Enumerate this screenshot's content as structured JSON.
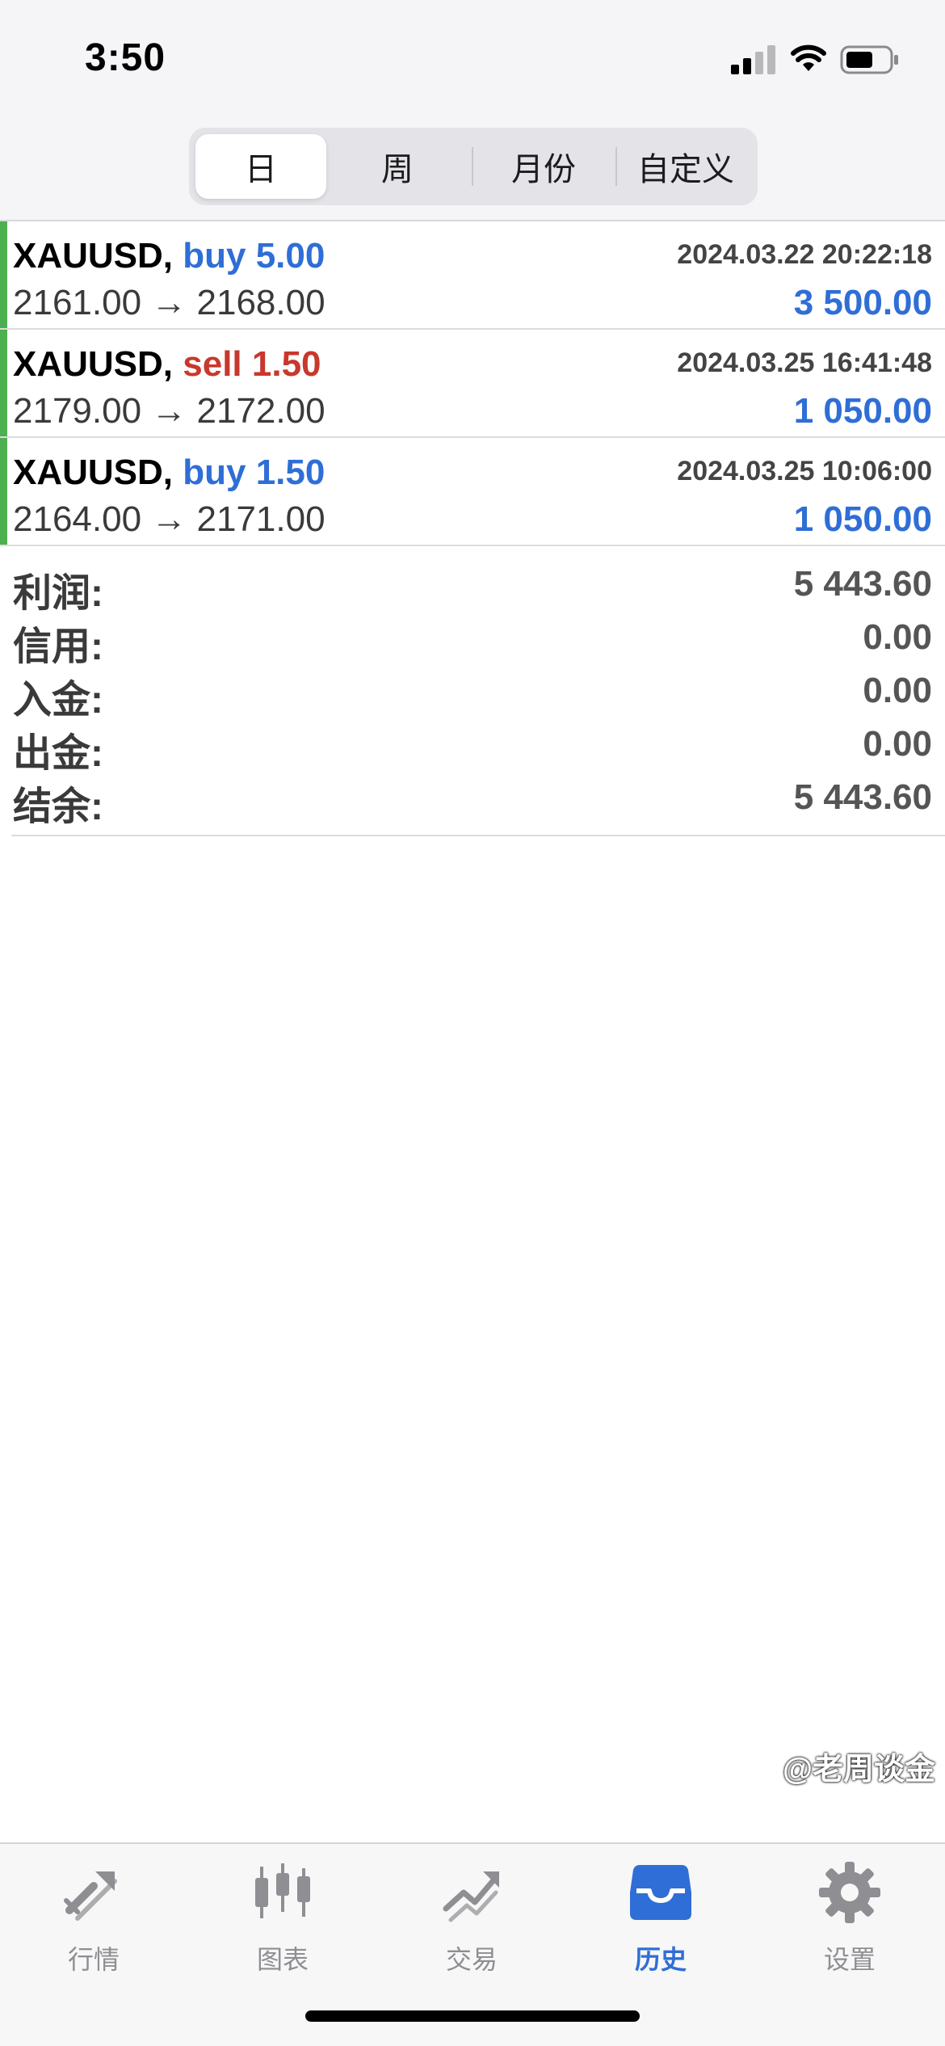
{
  "status_bar": {
    "time": "3:50"
  },
  "segments": [
    {
      "label": "日",
      "active": true
    },
    {
      "label": "周",
      "active": false
    },
    {
      "label": "月份",
      "active": false
    },
    {
      "label": "自定义",
      "active": false
    }
  ],
  "deals": [
    {
      "symbol": "XAUUSD",
      "comma": ",",
      "action": "buy 5.00",
      "type": "buy",
      "time": "2024.03.22 20:22:18",
      "prices": "2161.00 → 2168.00",
      "profit": "3 500.00"
    },
    {
      "symbol": "XAUUSD",
      "comma": ",",
      "action": "sell 1.50",
      "type": "sell",
      "time": "2024.03.25 16:41:48",
      "prices": "2179.00 → 2172.00",
      "profit": "1 050.00"
    },
    {
      "symbol": "XAUUSD",
      "comma": ",",
      "action": "buy 1.50",
      "type": "buy",
      "time": "2024.03.25 10:06:00",
      "prices": "2164.00 → 2171.00",
      "profit": "1 050.00"
    }
  ],
  "summary": [
    {
      "label": "利润:",
      "value": "5 443.60"
    },
    {
      "label": "信用:",
      "value": "0.00"
    },
    {
      "label": "入金:",
      "value": "0.00"
    },
    {
      "label": "出金:",
      "value": "0.00"
    },
    {
      "label": "结余:",
      "value": "5 443.60"
    }
  ],
  "tabs": [
    {
      "label": "行情",
      "icon": "quotes-icon",
      "active": false
    },
    {
      "label": "图表",
      "icon": "chart-icon",
      "active": false
    },
    {
      "label": "交易",
      "icon": "trade-icon",
      "active": false
    },
    {
      "label": "历史",
      "icon": "history-icon",
      "active": true
    },
    {
      "label": "设置",
      "icon": "settings-icon",
      "active": false
    }
  ],
  "watermark": "@老周谈金",
  "colors": {
    "buy": "#2f6ed6",
    "sell": "#c8382c",
    "accent_bar": "#4caf50",
    "active_tab": "#2f6ed6",
    "inactive_tab": "#8e8e93"
  }
}
